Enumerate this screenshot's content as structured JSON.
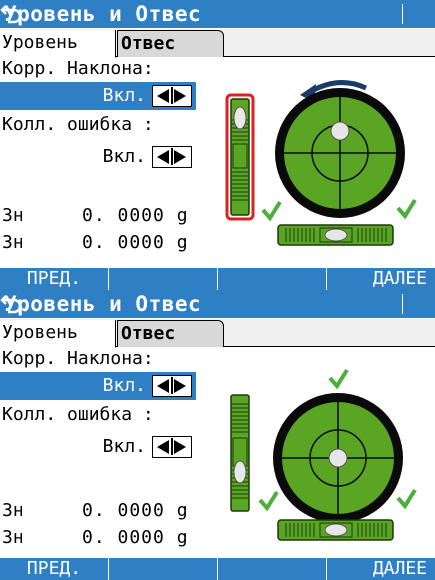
{
  "theme": {
    "title_bg": "#2f7fc4",
    "selection_bg": "#2f7fc4",
    "bubble_green": "#5aa624",
    "checkmark_green": "#4caf3a",
    "highlight_red": "#e02020"
  },
  "screens": [
    {
      "title": "Уровень и Отвес",
      "tabs": [
        {
          "label": "Уровень",
          "active": true
        },
        {
          "label": "Отвес",
          "active": false
        }
      ],
      "tilt_correction": {
        "label": "Корр. Наклона:",
        "value": "Вкл.",
        "highlighted": true
      },
      "collimation_error": {
        "label": "Колл. ошибка  :",
        "value": "Вкл.",
        "highlighted": false
      },
      "readings": [
        {
          "label": "Зн:",
          "value": "0. 0000  g"
        },
        {
          "label": "Зн:",
          "value": "0. 0000  g"
        }
      ],
      "softkeys": [
        "ПРЕД.",
        "",
        "",
        "ДАЛЕЕ"
      ],
      "vertical_vial_selected": true
    },
    {
      "title": "Уровень и Отвес",
      "tabs": [
        {
          "label": "Уровень",
          "active": false
        },
        {
          "label": "Отвес",
          "active": true
        }
      ],
      "tilt_correction": {
        "label": "Корр. Наклона:",
        "value": "Вкл.",
        "highlighted": true
      },
      "collimation_error": {
        "label": "Колл. ошибка  :",
        "value": "Вкл.",
        "highlighted": false
      },
      "readings": [
        {
          "label": "Зн:",
          "value": "0. 0000  g"
        },
        {
          "label": "Зн:",
          "value": "0. 0000  g"
        }
      ],
      "softkeys": [
        "ПРЕД.",
        "",
        "",
        "ДАЛЕЕ"
      ],
      "vertical_vial_selected": false
    }
  ],
  "icons": {
    "back": "back-arrow-icon",
    "rotate": "rotate-arrow-icon",
    "check": "checkmark-icon",
    "bubble": "level-bubble-icon"
  }
}
